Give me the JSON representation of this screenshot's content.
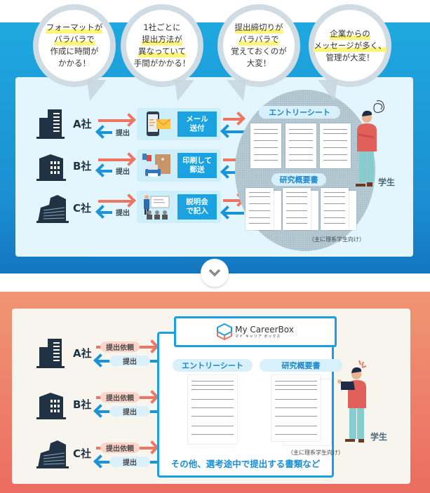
{
  "colors": {
    "top_band": "#1ea8e0",
    "top_panel": "#e3f6fd",
    "bottom_band": "#ef8a6c",
    "bottom_panel": "#f8f5ef",
    "accent_blue": "#1a9fe0",
    "arrow_red": "#ee7563",
    "highlight_yellow": "#fff57a",
    "building_navy": "#1f3344"
  },
  "top": {
    "bubbles": [
      {
        "lines": [
          {
            "text": "フォーマットが",
            "hl": true
          },
          {
            "text": "バラバラで",
            "hl": true
          },
          {
            "text": "作成に時間が",
            "hl": false
          },
          {
            "text": "かかる！",
            "hl": false
          }
        ]
      },
      {
        "lines": [
          {
            "text": "1社ごとに",
            "hl": false
          },
          {
            "text": "提出方法が",
            "hl": true
          },
          {
            "text": "異なっていて",
            "hl": true
          },
          {
            "text": "手間がかかる！",
            "hl": false
          }
        ]
      },
      {
        "lines": [
          {
            "text": "提出締切りが",
            "hl": true
          },
          {
            "text": "バラバラで",
            "hl": true
          },
          {
            "text": "覚えておくのが",
            "hl": false
          },
          {
            "text": "大変！",
            "hl": false
          }
        ]
      },
      {
        "lines": [
          {
            "text": "企業からの",
            "hl": true
          },
          {
            "text": "メッセージが多く、",
            "hl": true
          },
          {
            "text": "管理が大変！",
            "hl": false
          }
        ]
      }
    ],
    "companies": [
      {
        "name": "A社",
        "submit_label": "提出",
        "method_icon": "smartphone-mail-icon",
        "method_lines": [
          "メール",
          "送付"
        ]
      },
      {
        "name": "B社",
        "submit_label": "提出",
        "method_icon": "printer-envelope-icon",
        "method_lines": [
          "印刷して",
          "郵送"
        ]
      },
      {
        "name": "C社",
        "submit_label": "提出",
        "method_icon": "presentation-icon",
        "method_lines": [
          "説明会",
          "で記入"
        ]
      }
    ],
    "entry_sheet_label": "エントリーシート",
    "research_summary_label": "研究概要書",
    "research_note": "（主に理系学生向け）",
    "student_label": "学生"
  },
  "scroll_down_icon": "chevron-down-icon",
  "bottom": {
    "companies": [
      {
        "name": "A社",
        "request_label": "提出依頼",
        "submit_label": "提出"
      },
      {
        "name": "B社",
        "request_label": "提出依頼",
        "submit_label": "提出"
      },
      {
        "name": "C社",
        "request_label": "提出依頼",
        "submit_label": "提出"
      }
    ],
    "logo": {
      "name": "My CareerBox",
      "kana": "マイ キャリア ボックス"
    },
    "entry_sheet_label": "エントリーシート",
    "research_summary_label": "研究概要書",
    "research_note": "（主に理系学生向け）",
    "other_docs": "その他、選考途中で提出する書類など",
    "student_label": "学生"
  }
}
